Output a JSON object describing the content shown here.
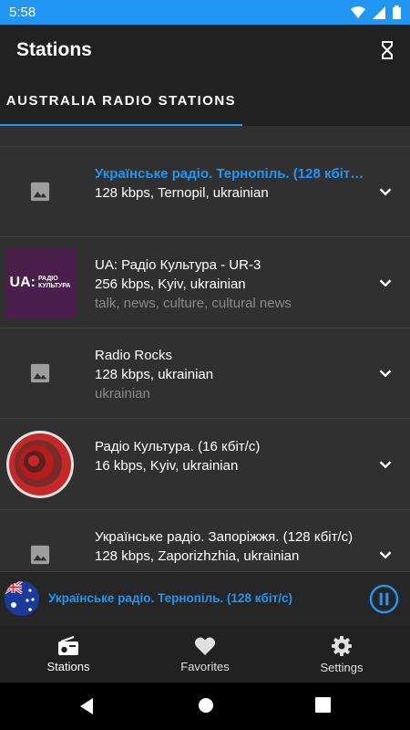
{
  "status_bar": {
    "time": "5:58",
    "icons": [
      "wifi-icon",
      "signal-icon",
      "battery-icon"
    ]
  },
  "app_bar": {
    "title": "Stations",
    "action_icon": "hourglass-icon"
  },
  "tabs": [
    {
      "label": "AUSTRALIA RADIO STATIONS",
      "selected": true
    }
  ],
  "stations": [
    {
      "name": "Українське радіо. Тернопіль. (128 кбіт/с)",
      "meta": "128 kbps, Ternopil, ukrainian",
      "tags": "",
      "thumb": "placeholder-image-icon",
      "playing": true
    },
    {
      "name": "UA: Радіо Культура - UR-3",
      "meta": "256 kbps, Kyiv, ukrainian",
      "tags": "talk, news, culture, cultural news",
      "thumb": "ua-radio-kultura-logo",
      "playing": false
    },
    {
      "name": "Radio Rocks",
      "meta": "128 kbps, ukrainian",
      "tags": "ukrainian",
      "thumb": "placeholder-image-icon",
      "playing": false
    },
    {
      "name": "Радіо Культура. (16 кбіт/с)",
      "meta": "16 kbps, Kyiv, ukrainian",
      "tags": "",
      "thumb": "red-circle-logo",
      "playing": false
    },
    {
      "name": "Українське радіо. Запоріжжя. (128 кбіт/с)",
      "meta": "128 kbps, Zaporizhzhia, ukrainian",
      "tags": "",
      "thumb": "placeholder-image-icon",
      "playing": false
    }
  ],
  "logo_text": {
    "ua": "UA:",
    "line1": "РАДІО",
    "line2": "КУЛЬТУРА"
  },
  "mini_player": {
    "title": "Українське радіо. Тернопіль. (128 кбіт/с)",
    "flag": "australia-flag-icon",
    "state": "playing"
  },
  "bottom_nav": [
    {
      "label": "Stations",
      "icon": "radio-icon",
      "active": true
    },
    {
      "label": "Favorites",
      "icon": "heart-icon",
      "active": false
    },
    {
      "label": "Settings",
      "icon": "gear-icon",
      "active": false
    }
  ],
  "colors": {
    "accent": "#2196f3",
    "background": "#303030",
    "toolbar": "#212121"
  }
}
